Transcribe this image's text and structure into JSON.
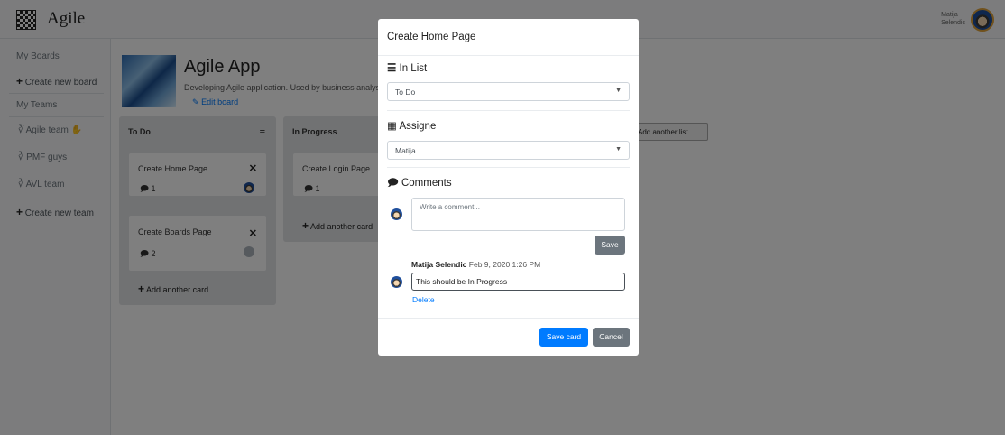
{
  "app": {
    "brand": "Agile"
  },
  "user": {
    "first_name": "Matija",
    "last_name": "Selendic"
  },
  "sidebar": {
    "my_boards": "My Boards",
    "create_board": "Create new board",
    "my_teams": "My Teams",
    "teams": [
      "Agile team",
      "PMF guys",
      "AVL team"
    ],
    "create_team": "Create new team"
  },
  "board": {
    "title": "Agile App",
    "description": "Developing Agile application. Used by business analysts",
    "edit": "Edit board",
    "lists": [
      {
        "title": "To Do",
        "cards": [
          {
            "title": "Create Home Page",
            "comments": "1"
          },
          {
            "title": "Create Boards Page",
            "comments": "2"
          }
        ],
        "add_card": "Add another card"
      },
      {
        "title": "In Progress",
        "cards": [
          {
            "title": "Create Login Page",
            "comments": "1"
          }
        ],
        "add_card": "Add another card"
      }
    ],
    "add_list": "Add another list"
  },
  "modal": {
    "title": "Create Home Page",
    "in_list_label": "In List",
    "in_list_value": "To Do",
    "assignee_label": "Assigne",
    "assignee_value": "Matija",
    "comments_label": "Comments",
    "comment_placeholder": "Write a comment...",
    "save_label": "Save",
    "comment": {
      "author": "Matija Selendic",
      "date": "Feb 9, 2020 1:26 PM",
      "text": "This should be In Progress",
      "delete_label": "Delete"
    },
    "save_card_label": "Save card",
    "cancel_label": "Cancel"
  },
  "colors": {
    "primary": "#007bff",
    "secondary": "#6c757d",
    "list_bg": "#e2e4e6"
  }
}
